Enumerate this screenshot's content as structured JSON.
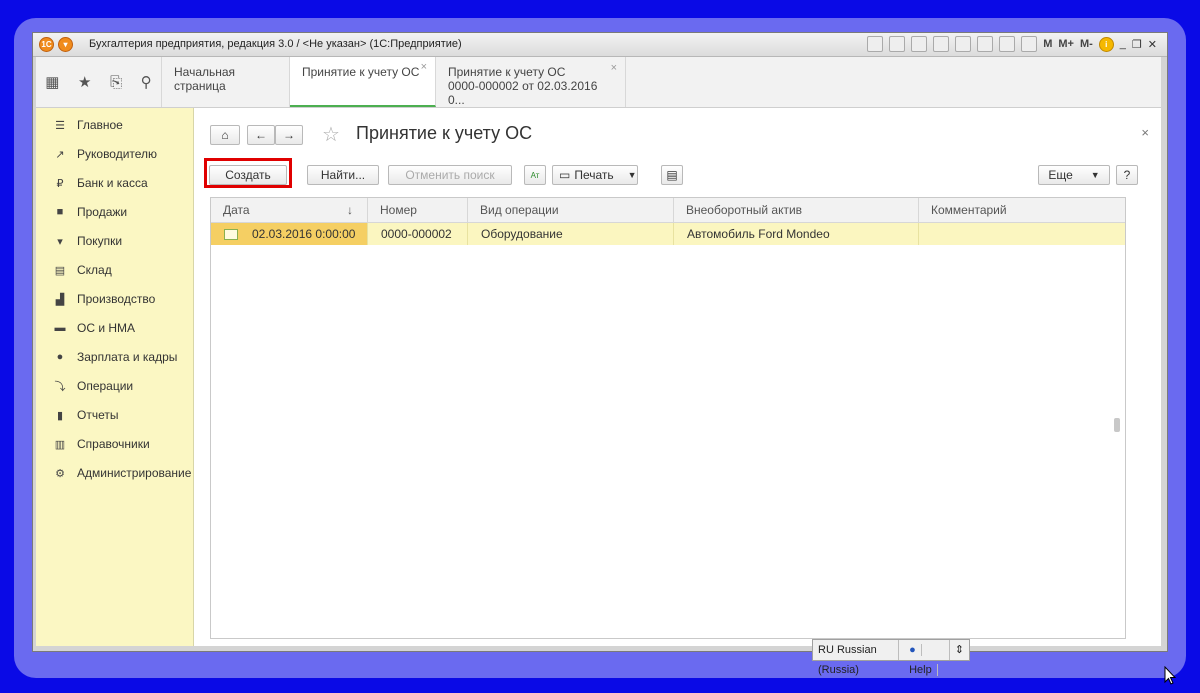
{
  "window": {
    "title": "Бухгалтерия предприятия, редакция 3.0 / <Не указан>  (1С:Предприятие)",
    "memory_labels": [
      "M",
      "M+",
      "M-"
    ]
  },
  "tabs": [
    {
      "label": "Начальная страница"
    },
    {
      "label": "Принятие к учету ОС"
    },
    {
      "label": "Принятие к учету ОС",
      "label2": "0000-000002 от 02.03.2016 0..."
    }
  ],
  "sidebar": {
    "items": [
      {
        "label": "Главное",
        "icon": "menu-icon"
      },
      {
        "label": "Руководителю",
        "icon": "trend-icon"
      },
      {
        "label": "Банк и касса",
        "icon": "ruble-icon"
      },
      {
        "label": "Продажи",
        "icon": "bag-icon"
      },
      {
        "label": "Покупки",
        "icon": "cart-icon"
      },
      {
        "label": "Склад",
        "icon": "warehouse-icon"
      },
      {
        "label": "Производство",
        "icon": "factory-icon"
      },
      {
        "label": "ОС и НМА",
        "icon": "truck-icon"
      },
      {
        "label": "Зарплата и кадры",
        "icon": "person-icon"
      },
      {
        "label": "Операции",
        "icon": "operations-icon"
      },
      {
        "label": "Отчеты",
        "icon": "chart-icon"
      },
      {
        "label": "Справочники",
        "icon": "book-icon"
      },
      {
        "label": "Администрирование",
        "icon": "gear-icon"
      }
    ]
  },
  "page": {
    "title": "Принятие к учету ОС"
  },
  "toolbar": {
    "create": "Создать",
    "find": "Найти...",
    "cancel_search": "Отменить поиск",
    "print": "Печать",
    "more": "Еще",
    "help": "?"
  },
  "table": {
    "headers": [
      "Дата",
      "Номер",
      "Вид операции",
      "Внеоборотный актив",
      "Комментарий"
    ],
    "sort_indicator": "↓",
    "rows": [
      {
        "date": "02.03.2016 0:00:00",
        "number": "0000-000002",
        "operation": "Оборудование",
        "asset": "Автомобиль Ford Mondeo",
        "comment": ""
      }
    ]
  },
  "statusbar": {
    "language": "RU Russian (Russia)",
    "help": "Help"
  },
  "colors": {
    "sidebar_bg": "#fbf7c3",
    "selected_row": "#f5cf63",
    "accent_tab": "#4caf50",
    "highlight_frame": "#e00000",
    "desktop": "#0a0ae6"
  }
}
